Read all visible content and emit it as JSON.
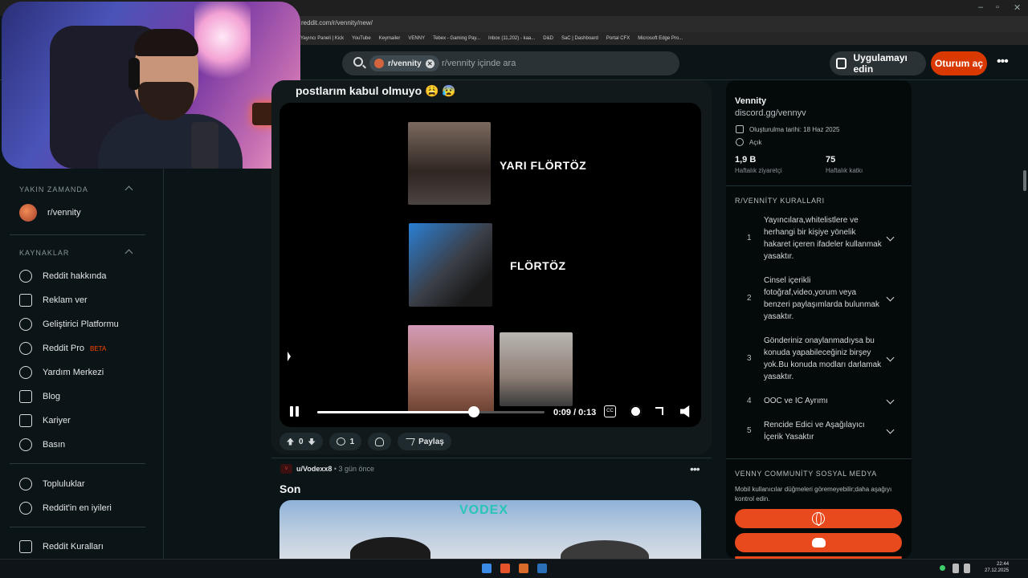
{
  "browser": {
    "url": "reddit.com/r/vennity/new/",
    "bookmarks": [
      "Yayıncı Paneli | Kick",
      "YouTube",
      "Keymailer",
      "VENNY",
      "Tebex - Gaming Pay...",
      "Inbox (11,202) - kaa...",
      "D&D",
      "SaC | Dashboard",
      "Portal CFX",
      "Microsoft Edge Pro..."
    ]
  },
  "header": {
    "search_chip": "r/vennity",
    "search_placeholder": "r/vennity içinde ara",
    "app_button": "Uygulamayı edin",
    "login_button": "Oturum aç",
    "more": "•••"
  },
  "left_sidebar": {
    "recent_title": "YAKIN ZAMANDA",
    "recent_item": "r/vennity",
    "resources_title": "KAYNAKLAR",
    "resources": [
      {
        "label": "Reddit hakkında",
        "icon": "alien-icon"
      },
      {
        "label": "Reklam ver",
        "icon": "megaphone-icon"
      },
      {
        "label": "Geliştirici Platformu",
        "icon": "dev-platform-icon"
      },
      {
        "label": "Reddit Pro",
        "icon": "pro-icon",
        "badge": "BETA"
      },
      {
        "label": "Yardım Merkezi",
        "icon": "help-icon"
      },
      {
        "label": "Blog",
        "icon": "book-icon"
      },
      {
        "label": "Kariyer",
        "icon": "briefcase-icon"
      },
      {
        "label": "Basın",
        "icon": "mic-icon"
      }
    ],
    "communities": "Topluluklar",
    "best_of": "Reddit'in en iyileri",
    "rules": "Reddit Kuralları"
  },
  "post1": {
    "title": "postlarım kabul olmuyo 😩 😰",
    "video_labels": [
      "YARI FLÖRTÖZ",
      "FLÖRTÖZ"
    ],
    "progress": 0.69,
    "time": "0:09 / 0:13",
    "cc": "CC",
    "votes": "0",
    "comments": "1",
    "share": "Paylaş"
  },
  "post2": {
    "author": "u/Vodexx8",
    "time": "• 3 gün önce",
    "title": "Son",
    "image_text": "VODEX",
    "more": "•••"
  },
  "right_sidebar": {
    "name": "Vennity",
    "discord": "discord.gg/vennyv",
    "created": "Oluşturulma tarihi: 18 Haz 2025",
    "status": "Açık",
    "stats": [
      {
        "value": "1,9 B",
        "label": "Haftalık ziyaretçi"
      },
      {
        "value": "75",
        "label": "Haftalık katkı"
      }
    ],
    "rules_title": "R/VENNİTY KURALLARI",
    "rules": [
      {
        "n": "1",
        "text": "Yayıncılara,whitelistlere ve herhangi bir kişiye yönelik hakaret içeren ifadeler kullanmak yasaktır."
      },
      {
        "n": "2",
        "text": "Cinsel içerikli fotoğraf,video,yorum veya benzeri paylaşımlarda bulunmak yasaktır."
      },
      {
        "n": "3",
        "text": "Gönderiniz onaylanmadıysa bu konuda yapabileceğiniz birşey yok.Bu konuda modları darlamak yasaktır."
      },
      {
        "n": "4",
        "text": "OOC ve IC Ayrımı"
      },
      {
        "n": "5",
        "text": "Rencide Edici ve Aşağılayıcı İçerik Yasaktır"
      }
    ],
    "social_title": "VENNY COMMUNİTY SOSYAL MEDYA",
    "social_note": "Mobil kullanıcılar düğmeleri göremeyebilir;daha aşağıyı kontrol edin."
  },
  "taskbar": {
    "time": "22:44",
    "date": "27.12.2025"
  },
  "colors": {
    "accent": "#d93900",
    "social_button": "#e8491d",
    "background": "#0b1416"
  }
}
